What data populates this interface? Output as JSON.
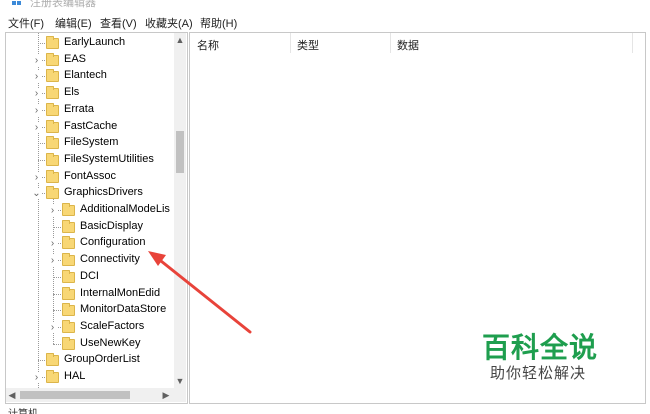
{
  "window": {
    "title": "注册表编辑器",
    "icon": "regedit-icon"
  },
  "menu": [
    {
      "label": "文件(F)"
    },
    {
      "label": "编辑(E)"
    },
    {
      "label": "查看(V)"
    },
    {
      "label": "收藏夹(A)"
    },
    {
      "label": "帮助(H)"
    }
  ],
  "tree": {
    "rows": [
      {
        "label": "EarlyLaunch",
        "level": 1,
        "expander": "none"
      },
      {
        "label": "EAS",
        "level": 1,
        "expander": "collapsed"
      },
      {
        "label": "Elantech",
        "level": 1,
        "expander": "collapsed"
      },
      {
        "label": "Els",
        "level": 1,
        "expander": "collapsed"
      },
      {
        "label": "Errata",
        "level": 1,
        "expander": "collapsed"
      },
      {
        "label": "FastCache",
        "level": 1,
        "expander": "collapsed"
      },
      {
        "label": "FileSystem",
        "level": 1,
        "expander": "none"
      },
      {
        "label": "FileSystemUtilities",
        "level": 1,
        "expander": "none"
      },
      {
        "label": "FontAssoc",
        "level": 1,
        "expander": "collapsed"
      },
      {
        "label": "GraphicsDrivers",
        "level": 1,
        "expander": "expanded"
      },
      {
        "label": "AdditionalModeLis",
        "level": 2,
        "expander": "collapsed"
      },
      {
        "label": "BasicDisplay",
        "level": 2,
        "expander": "none"
      },
      {
        "label": "Configuration",
        "level": 2,
        "expander": "collapsed"
      },
      {
        "label": "Connectivity",
        "level": 2,
        "expander": "collapsed"
      },
      {
        "label": "DCI",
        "level": 2,
        "expander": "none"
      },
      {
        "label": "InternalMonEdid",
        "level": 2,
        "expander": "none"
      },
      {
        "label": "MonitorDataStore",
        "level": 2,
        "expander": "none"
      },
      {
        "label": "ScaleFactors",
        "level": 2,
        "expander": "collapsed"
      },
      {
        "label": "UseNewKey",
        "level": 2,
        "expander": "none"
      },
      {
        "label": "GroupOrderList",
        "level": 1,
        "expander": "none"
      },
      {
        "label": "HAL",
        "level": 1,
        "expander": "collapsed"
      }
    ]
  },
  "list": {
    "columns": [
      {
        "label": "名称"
      },
      {
        "label": "类型"
      },
      {
        "label": "数据"
      }
    ]
  },
  "status": {
    "path": "计算机"
  },
  "watermark": {
    "title": "百科全说",
    "subtitle": "助你轻松解决",
    "color": "#1e9e4e"
  },
  "annotation": {
    "arrow_color": "#e8433a"
  },
  "icons": {
    "expand_collapsed": "chevron-right-icon",
    "expand_expanded": "chevron-down-icon",
    "folder": "folder-icon",
    "scroll_up": "scroll-up-icon",
    "scroll_down": "scroll-down-icon",
    "scroll_left": "scroll-left-icon",
    "scroll_right": "scroll-right-icon"
  }
}
